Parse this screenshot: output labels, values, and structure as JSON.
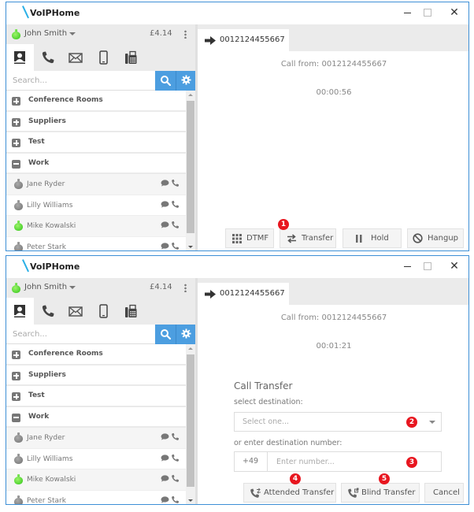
{
  "colors": {
    "accent": "#4c9ee0",
    "window_border": "#3d8fd6",
    "status_online": "#2fc418",
    "status_offline": "#707070",
    "badge": "#e8161f"
  },
  "windows": [
    {
      "title": "VoIPHome",
      "user": {
        "name": "John Smith",
        "status": "online",
        "balance": "£4.14"
      },
      "nav_tabs": [
        {
          "icon": "contacts-icon",
          "active": true
        },
        {
          "icon": "phone-icon",
          "active": false
        },
        {
          "icon": "mail-icon",
          "active": false
        },
        {
          "icon": "mobile-icon",
          "active": false
        },
        {
          "icon": "fax-icon",
          "active": false
        }
      ],
      "search": {
        "placeholder": "Search...",
        "value": ""
      },
      "groups": [
        {
          "label": "Conference Rooms",
          "expanded": false
        },
        {
          "label": "Suppliers",
          "expanded": false
        },
        {
          "label": "Test",
          "expanded": false
        },
        {
          "label": "Work",
          "expanded": true
        }
      ],
      "contacts": [
        {
          "name": "Jane Ryder",
          "status": "offline"
        },
        {
          "name": "Lilly Williams",
          "status": "offline"
        },
        {
          "name": "Mike Kowalski",
          "status": "online"
        },
        {
          "name": "Peter Stark",
          "status": "offline"
        }
      ],
      "call": {
        "tab_label": "0012124455667",
        "call_from": "Call from: 0012124455667",
        "timer": "00:00:56"
      },
      "actions": {
        "dtmf": "DTMF",
        "transfer": "Transfer",
        "hold": "Hold",
        "hangup": "Hangup"
      },
      "badges": [
        "1"
      ]
    },
    {
      "title": "VoIPHome",
      "user": {
        "name": "John Smith",
        "status": "online",
        "balance": "£4.14"
      },
      "search": {
        "placeholder": "Search...",
        "value": ""
      },
      "groups": [
        {
          "label": "Conference Rooms",
          "expanded": false
        },
        {
          "label": "Suppliers",
          "expanded": false
        },
        {
          "label": "Test",
          "expanded": false
        },
        {
          "label": "Work",
          "expanded": true
        }
      ],
      "contacts": [
        {
          "name": "Jane Ryder",
          "status": "offline"
        },
        {
          "name": "Lilly Williams",
          "status": "offline"
        },
        {
          "name": "Mike Kowalski",
          "status": "online"
        },
        {
          "name": "Peter Stark",
          "status": "offline"
        }
      ],
      "call": {
        "tab_label": "0012124455667",
        "call_from": "Call from: 0012124455667",
        "timer": "00:01:21"
      },
      "transfer": {
        "title": "Call Transfer",
        "select_label": "select destination:",
        "select_placeholder": "Select one...",
        "number_label": "or enter destination number:",
        "prefix": "+49",
        "number_placeholder": "Enter number...",
        "number_value": "",
        "attended": "Attended Transfer",
        "blind": "Blind Transfer",
        "cancel": "Cancel"
      },
      "badges": [
        "2",
        "3",
        "4",
        "5"
      ]
    }
  ]
}
